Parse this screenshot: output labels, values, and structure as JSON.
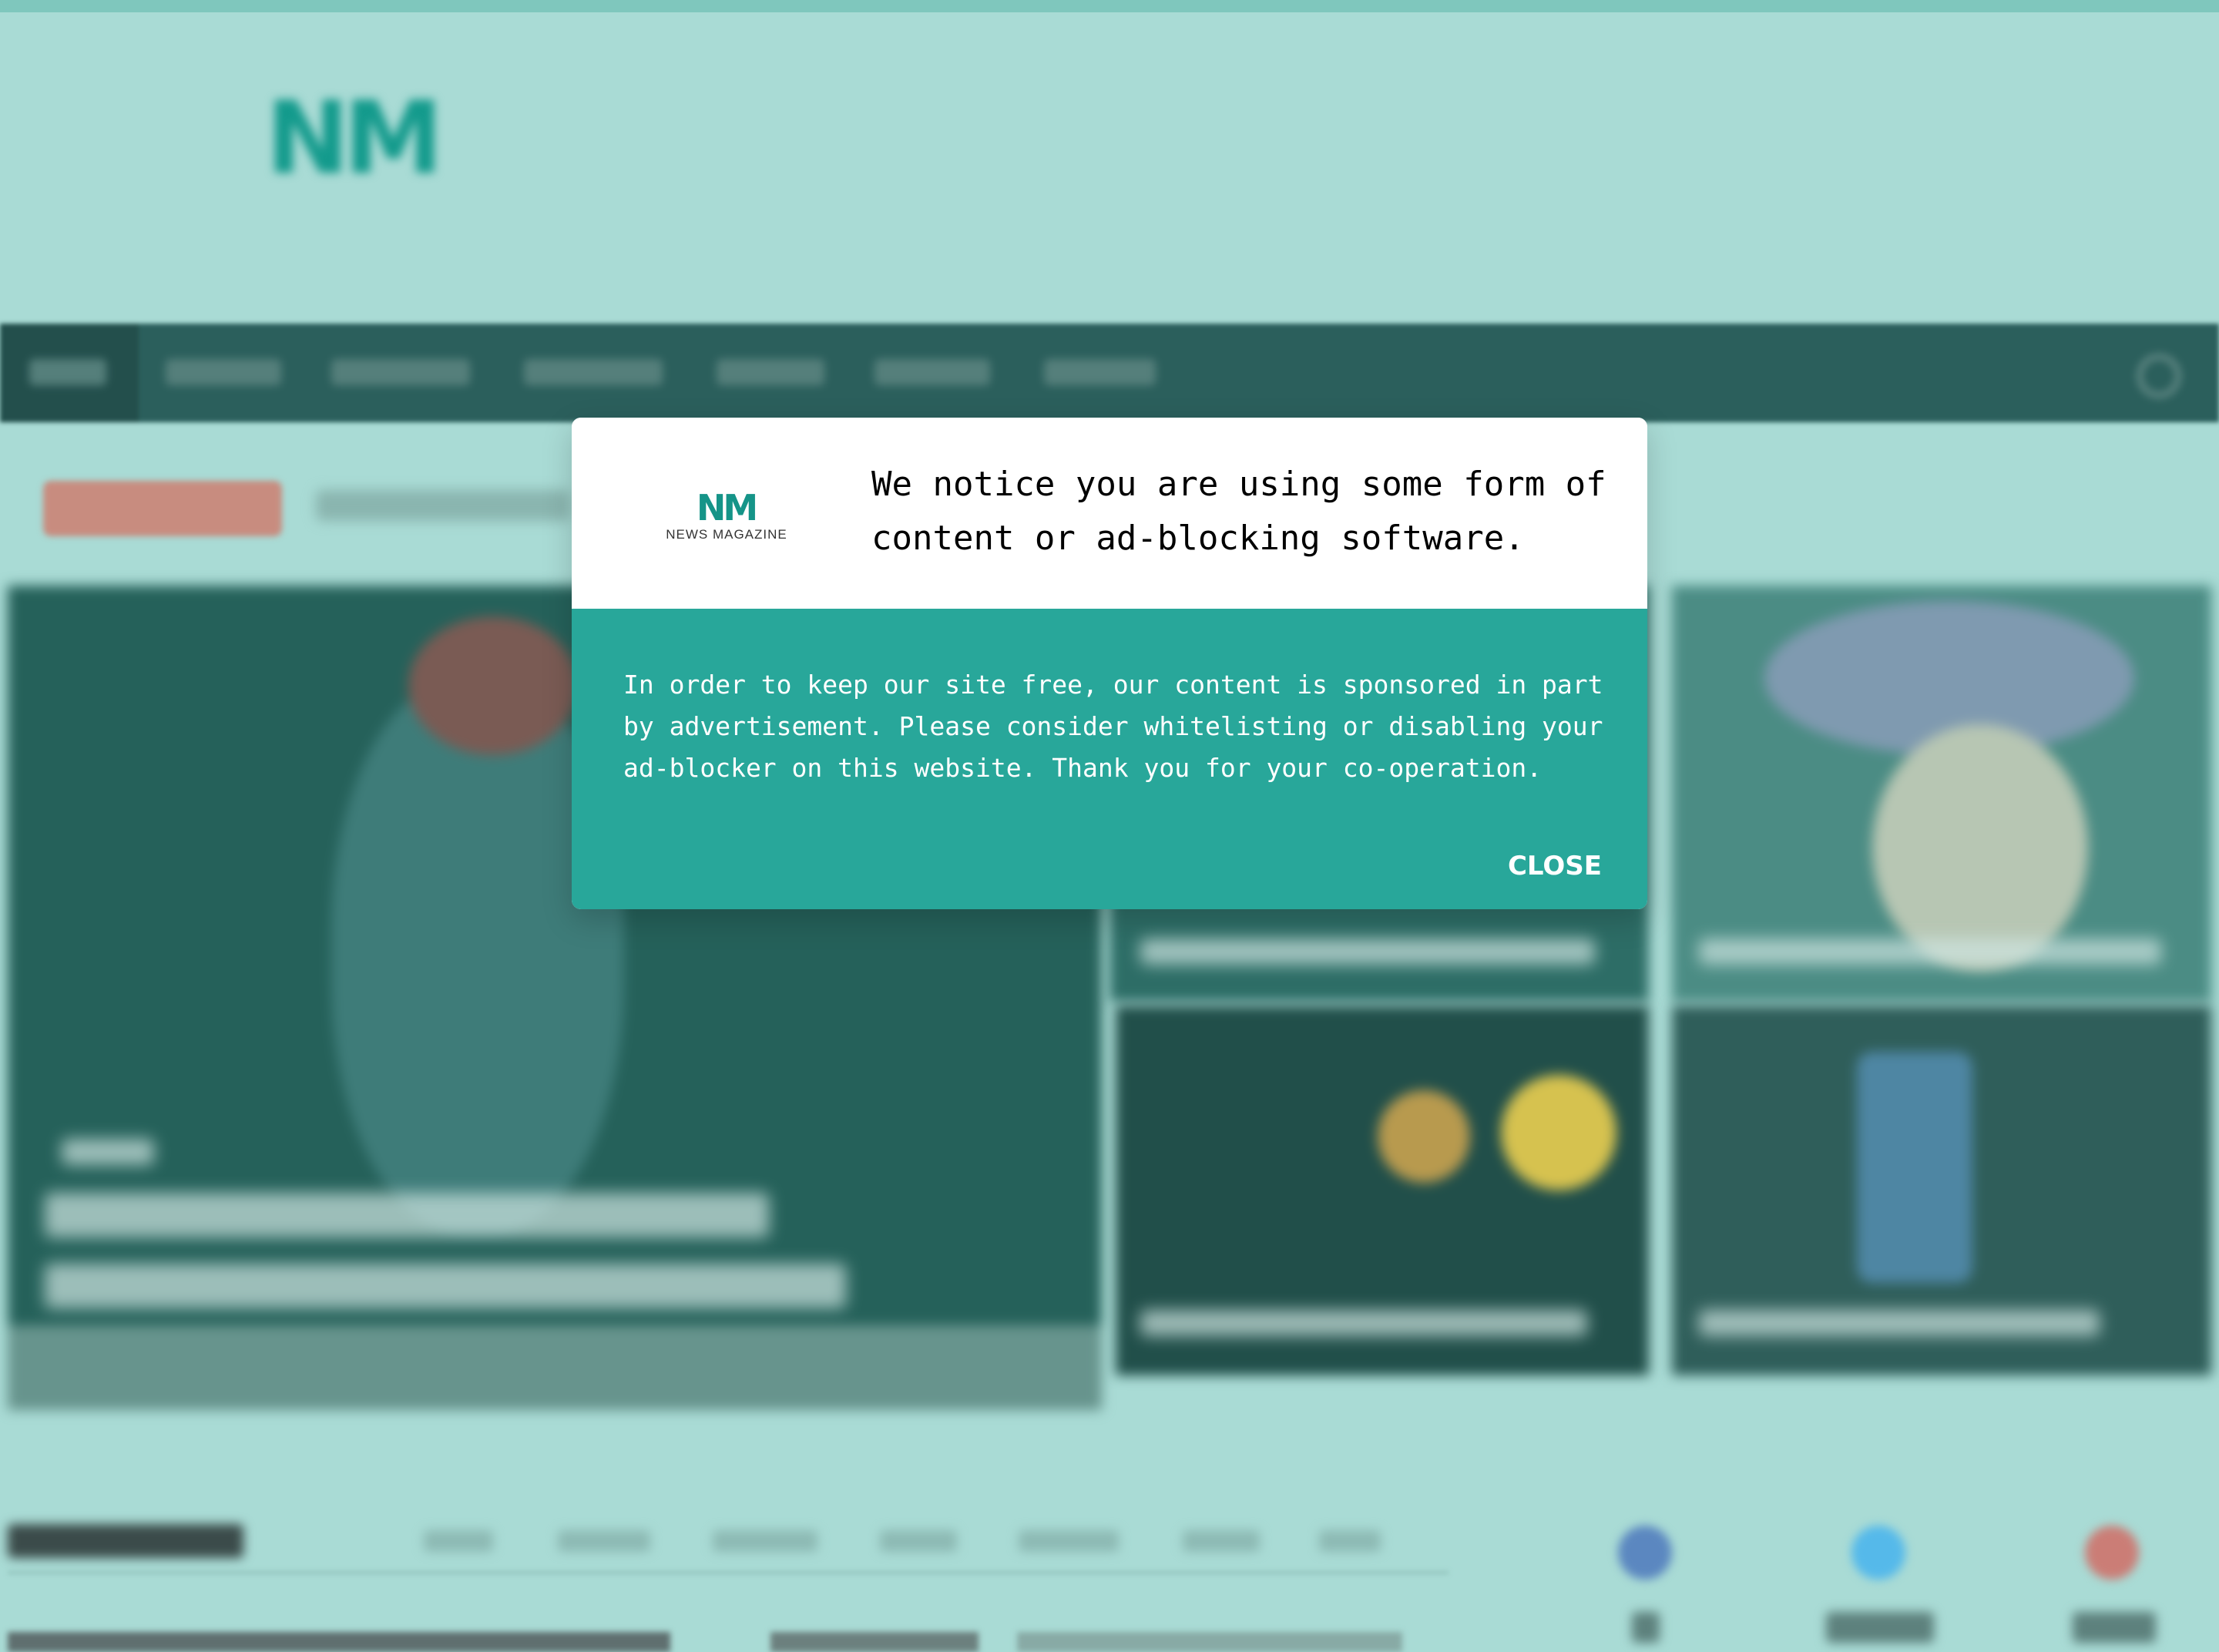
{
  "background": {
    "logo": "NM",
    "colors": {
      "page": "#a9dbd5",
      "accent": "#139a8c",
      "nav": "#2b5f5c"
    }
  },
  "modal": {
    "logo_mark": "NM",
    "logo_text": "NEWS MAGAZINE",
    "title": "We notice you are using some form of content or ad-blocking software.",
    "message": "In order to keep our site free, our content is sponsored in part by advertisement. Please consider whitelisting or disabling your ad-blocker on this website. Thank you for your co-operation.",
    "close_label": "CLOSE",
    "colors": {
      "header": "#ffffff",
      "body": "#28a79a",
      "text_light": "#ffffff"
    }
  }
}
